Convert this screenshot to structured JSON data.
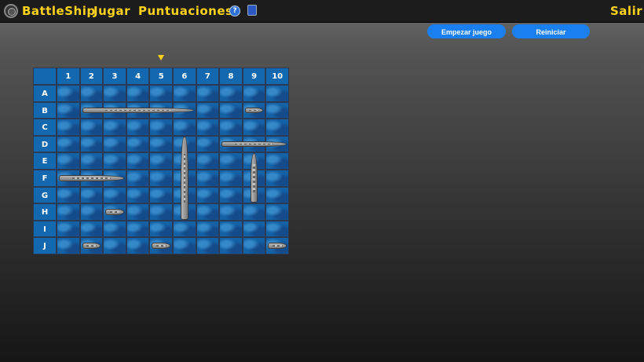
{
  "nav": {
    "brand": "BattleShip",
    "play": "Jugar",
    "scores": "Puntuaciones",
    "help_glyph": "?",
    "exit": "Salir"
  },
  "buttons": {
    "start": "Empezar juego",
    "restart": "Reiniciar"
  },
  "board": {
    "columns": [
      "1",
      "2",
      "3",
      "4",
      "5",
      "6",
      "7",
      "8",
      "9",
      "10"
    ],
    "rows": [
      "A",
      "B",
      "C",
      "D",
      "E",
      "F",
      "G",
      "H",
      "I",
      "J"
    ],
    "selected_column": "5",
    "ships": [
      {
        "row": "B",
        "col": 2,
        "length": 5,
        "orientation": "horizontal"
      },
      {
        "row": "B",
        "col": 9,
        "length": 1,
        "orientation": "horizontal"
      },
      {
        "row": "D",
        "col": 6,
        "length": 5,
        "orientation": "vertical"
      },
      {
        "row": "D",
        "col": 8,
        "length": 3,
        "orientation": "horizontal"
      },
      {
        "row": "E",
        "col": 9,
        "length": 3,
        "orientation": "vertical"
      },
      {
        "row": "F",
        "col": 1,
        "length": 3,
        "orientation": "horizontal"
      },
      {
        "row": "H",
        "col": 3,
        "length": 1,
        "orientation": "horizontal"
      },
      {
        "row": "J",
        "col": 2,
        "length": 1,
        "orientation": "horizontal"
      },
      {
        "row": "J",
        "col": 5,
        "length": 1,
        "orientation": "horizontal"
      },
      {
        "row": "J",
        "col": 10,
        "length": 1,
        "orientation": "horizontal"
      }
    ]
  },
  "colors": {
    "accent_yellow": "#ffd21a",
    "button_blue": "#1a7ff0",
    "water_blue": "#1461a6"
  }
}
